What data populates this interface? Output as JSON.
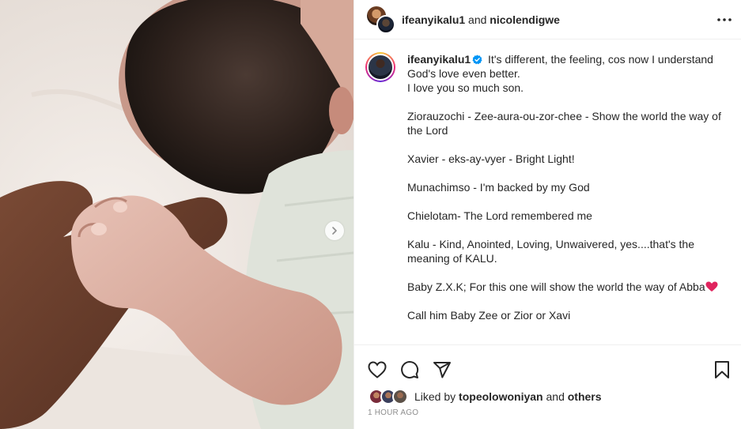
{
  "post": {
    "header": {
      "username": "ifeanyikalu1",
      "connector": "and",
      "collaborator": "nicolendigwe",
      "more_icon": "more-horizontal-icon"
    },
    "caption": {
      "username": "ifeanyikalu1",
      "verified_icon": "verified-badge-icon",
      "lines": [
        "It's different, the feeling, cos now I understand God's love even better.",
        "I love you so much son.",
        "Ziorauzochi - Zee-aura-ou-zor-chee - Show the world the way of the Lord",
        "Xavier - eks-ay-vyer - Bright Light!",
        "Munachimso - I'm backed by my God",
        "Chielotam- The Lord remembered me",
        "Kalu - Kind, Anointed, Loving, Unwaivered, yes....that's the meaning of KALU.",
        "Baby Z.X.K; For this one will show the world the way of Abba",
        "Call him Baby Zee or Zior or Xavi"
      ],
      "heart_emoji_icon": "red-heart-icon"
    },
    "actions": {
      "like_icon": "heart-outline-icon",
      "comment_icon": "comment-icon",
      "share_icon": "send-icon",
      "save_icon": "bookmark-icon"
    },
    "likes": {
      "prefix": "Liked by",
      "user": "topeolowoniyan",
      "connector": "and",
      "others": "others"
    },
    "timestamp": "1 HOUR AGO",
    "media": {
      "description_icon": "photo",
      "next_icon": "chevron-right-icon"
    }
  }
}
